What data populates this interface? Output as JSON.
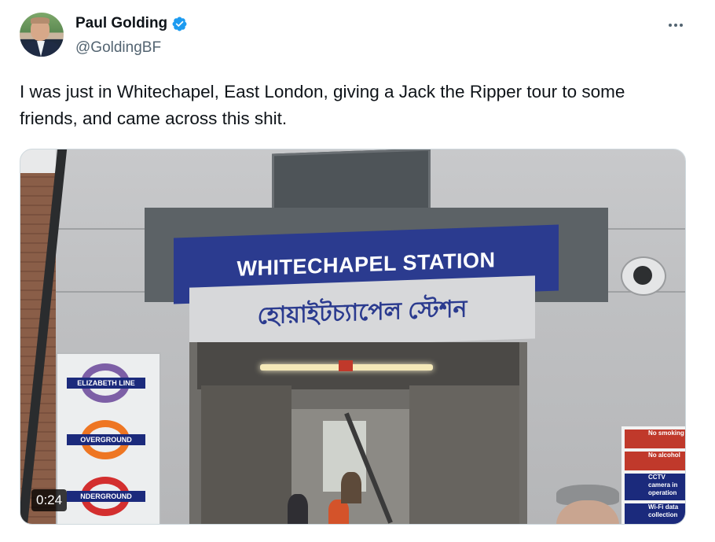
{
  "author": {
    "name": "Paul Golding",
    "handle": "@GoldingBF",
    "verified_icon": "verified-badge-icon",
    "avatar_icon": "avatar-photo"
  },
  "more_icon": "more-options-icon",
  "tweet": {
    "text": "I was just in Whitechapel, East London, giving a Jack the Ripper tour to some friends, and came across this shit."
  },
  "media": {
    "type": "video",
    "duration": "0:24",
    "sign_english": "WHITECHAPEL STATION",
    "sign_bengali": "হোয়াইটচ্যাপেল স্টেশন",
    "roundels": [
      "ELIZABETH LINE",
      "OVERGROUND",
      "NDERGROUND"
    ],
    "roundel_colors": [
      "#7d5fa6",
      "#ee7623",
      "#d32f2f"
    ],
    "safety_notices": [
      "No smoking",
      "No alcohol",
      "CCTV camera in operation",
      "Wi-Fi data collection"
    ]
  },
  "colors": {
    "verified": "#1d9bf0",
    "handle": "#536471",
    "station_blue": "#2b3b8f"
  }
}
